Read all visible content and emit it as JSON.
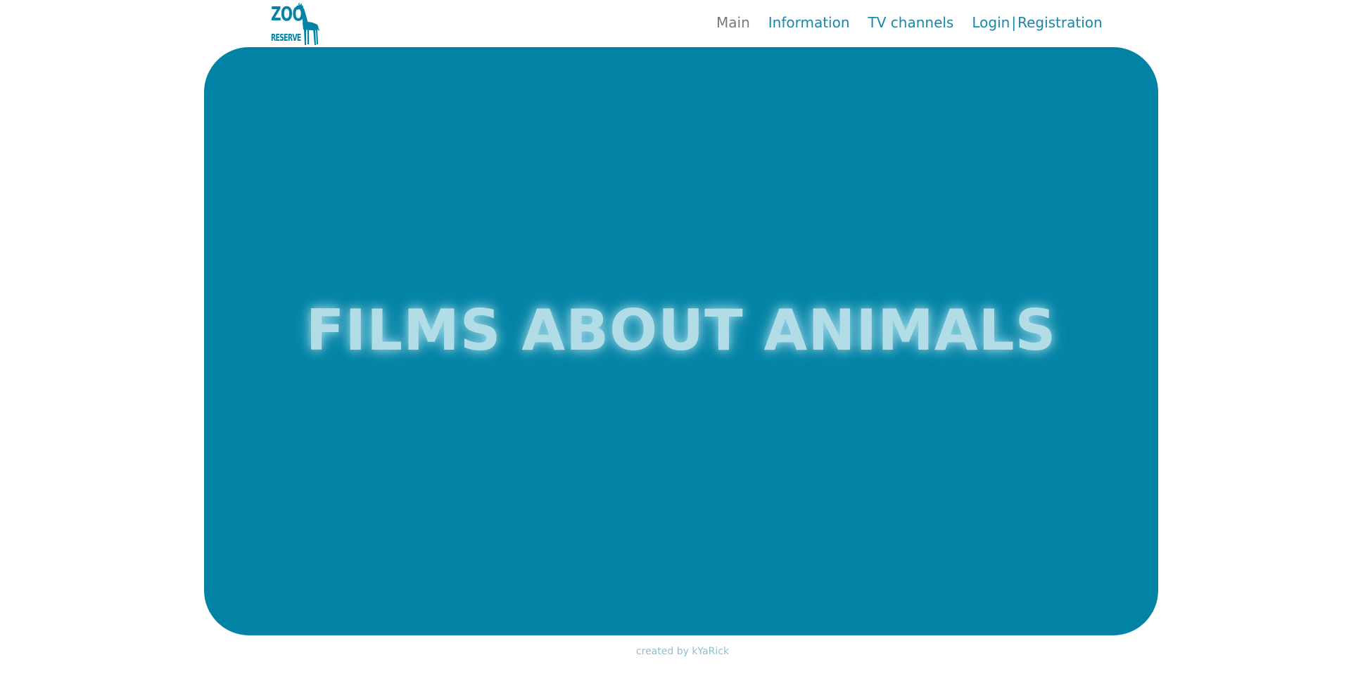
{
  "header": {
    "logo": {
      "line1": "ZOO",
      "line2": "RESERVE",
      "icon": "giraffe-icon"
    },
    "nav": {
      "main": "Main",
      "information": "Information",
      "tv_channels": "TV channels",
      "login": "Login",
      "separator": "|",
      "registration": "Registration"
    }
  },
  "hero": {
    "title": "FILMS ABOUT ANIMALS"
  },
  "footer": {
    "credit": "created by kYaRick"
  },
  "colors": {
    "accent": "#0283a5",
    "nav_link": "#1a86a8",
    "nav_active": "#7a7a7a",
    "hero_title": "#b3dde6",
    "footer_text": "#8fc0d0"
  }
}
